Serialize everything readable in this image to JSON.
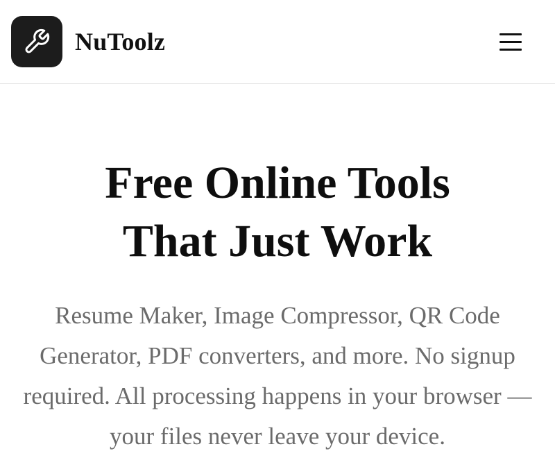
{
  "header": {
    "brand_name": "NuToolz",
    "logo_icon": "wrench-icon",
    "menu_icon": "hamburger-menu-icon"
  },
  "hero": {
    "title_line1": "Free Online Tools",
    "title_line2": "That Just Work",
    "subtitle": "Resume Maker, Image Compressor, QR Code Generator, PDF converters, and more. No signup required. All processing happens in your browser — your files never leave your device."
  },
  "colors": {
    "logo_background": "#1c1c1c",
    "title_text": "#0e0e0e",
    "subtitle_text": "#6b6b6b",
    "header_border": "#e6e6e6"
  }
}
